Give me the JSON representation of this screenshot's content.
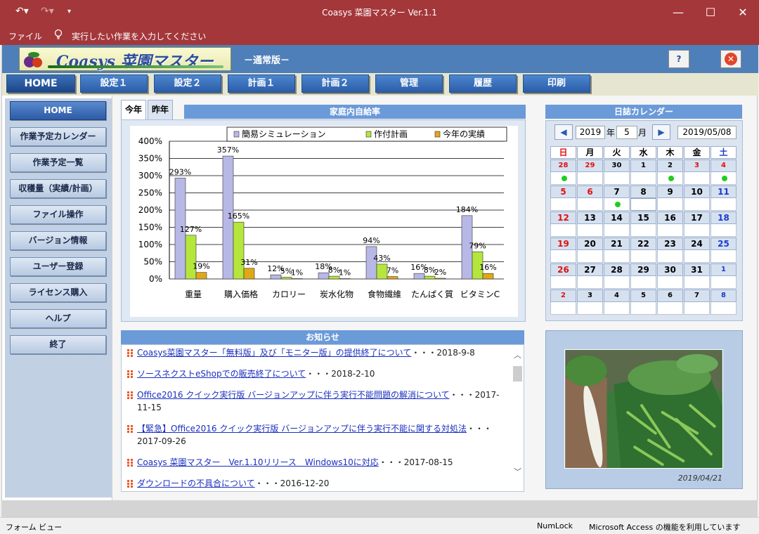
{
  "window": {
    "title": "Coasys 菜園マスター Ver.1.1",
    "minimize_glyph": "—",
    "maximize_glyph": "☐",
    "close_glyph": "✕"
  },
  "ribbon": {
    "file_label": "ファイル",
    "tell_me": "実行したい作業を入力してください"
  },
  "app_header": {
    "logo_text": "Coasys 菜園マスター",
    "edition": "－通常版－",
    "help_glyph": "?",
    "close_glyph": "✕"
  },
  "tabs": [
    "HOME",
    "設定１",
    "設定２",
    "計画１",
    "計画２",
    "管理",
    "履歴",
    "印刷"
  ],
  "sidebar": {
    "items": [
      "HOME",
      "作業予定カレンダー",
      "作業予定一覧",
      "収穫量（実績/計画）",
      "ファイル操作",
      "バージョン情報",
      "ユーザー登録",
      "ライセンス購入",
      "ヘルプ",
      "終了"
    ]
  },
  "chart_panel": {
    "tab_this": "今年",
    "tab_last": "昨年",
    "title": "家庭内自給率"
  },
  "chart_data": {
    "type": "bar",
    "title": "家庭内自給率",
    "categories": [
      "重量",
      "購入価格",
      "カロリー",
      "炭水化物",
      "食物繊維",
      "たんぱく質",
      "ビタミンC"
    ],
    "series": [
      {
        "name": "簡易シミュレーション",
        "values": [
          293,
          357,
          12,
          18,
          94,
          16,
          184
        ],
        "labels": [
          "293%",
          "357%",
          "12%",
          "18%",
          "94%",
          "16%",
          "184%"
        ],
        "color": "#b8b8e6"
      },
      {
        "name": "作付計画",
        "values": [
          127,
          165,
          5,
          8,
          43,
          8,
          79
        ],
        "labels": [
          "127%",
          "165%",
          "5%",
          "8%",
          "43%",
          "8%",
          "79%"
        ],
        "color": "#b4e63c"
      },
      {
        "name": "今年の実績",
        "values": [
          19,
          31,
          1,
          1,
          7,
          2,
          16
        ],
        "labels": [
          "19%",
          "31%",
          "1%",
          "1%",
          "7%",
          "2%",
          "16%"
        ],
        "color": "#e0a818"
      }
    ],
    "ylim": [
      0,
      400
    ],
    "yticks": [
      "0%",
      "50%",
      "100%",
      "150%",
      "200%",
      "250%",
      "300%",
      "350%",
      "400%"
    ],
    "grid": true,
    "legend": "top"
  },
  "calendar": {
    "title": "日誌カレンダー",
    "prev_glyph": "◀",
    "next_glyph": "▶",
    "year": "2019",
    "year_suffix": "年",
    "month": "5",
    "month_suffix": "月",
    "date": "2019/05/08",
    "weekdays": [
      "日",
      "月",
      "火",
      "水",
      "木",
      "金",
      "土"
    ],
    "weekday_colors": [
      "#e01010",
      "#000000",
      "#000000",
      "#000000",
      "#000000",
      "#000000",
      "#1a3acc"
    ],
    "weeks": [
      [
        "28",
        "29",
        "30",
        "1",
        "2",
        "3",
        "4"
      ],
      [
        "5",
        "6",
        "7",
        "8",
        "9",
        "10",
        "11"
      ],
      [
        "12",
        "13",
        "14",
        "15",
        "16",
        "17",
        "18"
      ],
      [
        "19",
        "20",
        "21",
        "22",
        "23",
        "24",
        "25"
      ],
      [
        "26",
        "27",
        "28",
        "29",
        "30",
        "31",
        "1"
      ],
      [
        "2",
        "3",
        "4",
        "5",
        "6",
        "7",
        "8"
      ]
    ],
    "day_colors": [
      [
        "#e01010",
        "#e01010",
        "#000000",
        "#000000",
        "#000000",
        "#e01010",
        "#e01010"
      ],
      [
        "#e01010",
        "#e01010",
        "#000000",
        "#000000",
        "#000000",
        "#000000",
        "#1a3acc"
      ],
      [
        "#e01010",
        "#000000",
        "#000000",
        "#000000",
        "#000000",
        "#000000",
        "#1a3acc"
      ],
      [
        "#e01010",
        "#000000",
        "#000000",
        "#000000",
        "#000000",
        "#000000",
        "#1a3acc"
      ],
      [
        "#e01010",
        "#000000",
        "#000000",
        "#000000",
        "#000000",
        "#000000",
        "#1a3acc"
      ],
      [
        "#e01010",
        "#000000",
        "#000000",
        "#000000",
        "#000000",
        "#000000",
        "#1a3acc"
      ]
    ],
    "small_weeks": [
      0,
      5
    ],
    "small_cells": [
      [
        4,
        6
      ]
    ],
    "journal_dots": [
      [
        0,
        0
      ],
      [
        0,
        4
      ],
      [
        0,
        6
      ],
      [
        1,
        2
      ]
    ],
    "today": [
      1,
      3
    ],
    "dot_color": "#22cc22"
  },
  "photo": {
    "date": "2019/04/21"
  },
  "news": {
    "title": "お知らせ",
    "items": [
      {
        "link": "Coasys菜園マスター「無料版」及び「モニター版」の提供終了について",
        "date": "・・・2018-9-8"
      },
      {
        "link": "ソースネクストeShopでの販売終了について",
        "date": "・・・2018-2-10"
      },
      {
        "link": "Office2016 クイック実行版 バージョンアップに伴う実行不能問題の解消について",
        "date": "・・・2017-11-15"
      },
      {
        "link": "【緊急】Office2016 クイック実行版 バージョンアップに伴う実行不能に関する対処法",
        "date": "・・・2017-09-26"
      },
      {
        "link": "Coasys 菜園マスター　Ver.1.10リリース　Windows10に対応",
        "date": "・・・2017-08-15"
      },
      {
        "link": "ダウンロードの不具合について",
        "date": "・・・2016-12-20"
      }
    ]
  },
  "status": {
    "left": "フォーム ビュー",
    "numlock": "NumLock",
    "right": "Microsoft Access の機能を利用しています"
  }
}
